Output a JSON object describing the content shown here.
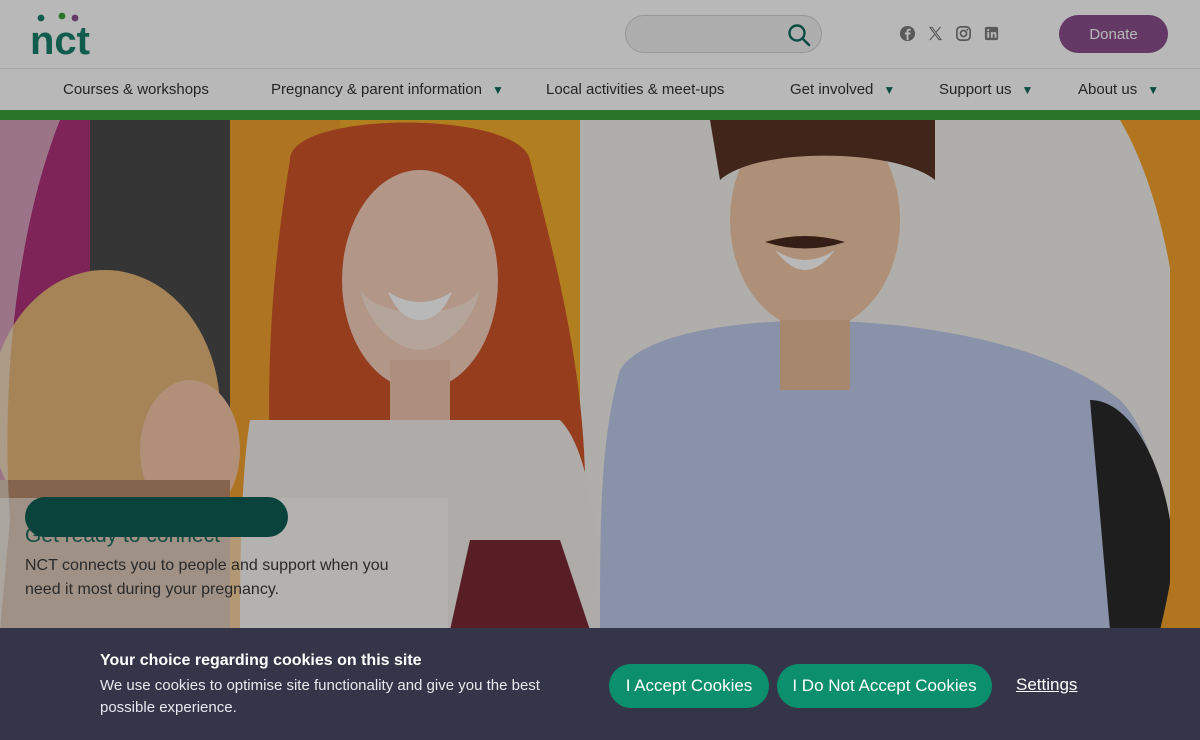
{
  "header": {
    "logo_text": "nct",
    "search": {
      "value": "",
      "placeholder": ""
    },
    "socials": [
      "facebook-icon",
      "x-icon",
      "instagram-icon",
      "linkedin-icon"
    ],
    "donate_label": "Donate"
  },
  "nav": {
    "items": [
      {
        "label": "Courses & workshops",
        "has_menu": false
      },
      {
        "label": "Pregnancy & parent information",
        "has_menu": true
      },
      {
        "label": "Local activities & meet-ups",
        "has_menu": false
      },
      {
        "label": "Get involved",
        "has_menu": true
      },
      {
        "label": "Support us",
        "has_menu": true
      },
      {
        "label": "About us",
        "has_menu": true
      }
    ],
    "caret": "▼"
  },
  "hero": {
    "title": "Get ready to connect",
    "text": "NCT connects you to people and support when you need it most during your pregnancy."
  },
  "cookie": {
    "title": "Your choice regarding cookies on this site",
    "text": "We use cookies to optimise site functionality and give you the best possible experience.",
    "accept_label": "I Accept Cookies",
    "reject_label": "I Do Not Accept Cookies",
    "settings_label": "Settings"
  },
  "colors": {
    "brand_green": "#0f6a5c",
    "donate_purple": "#8b4f8e",
    "nav_rule": "#3aa43a",
    "cookie_bg": "#353549",
    "cookie_button": "#0b8f6d"
  }
}
